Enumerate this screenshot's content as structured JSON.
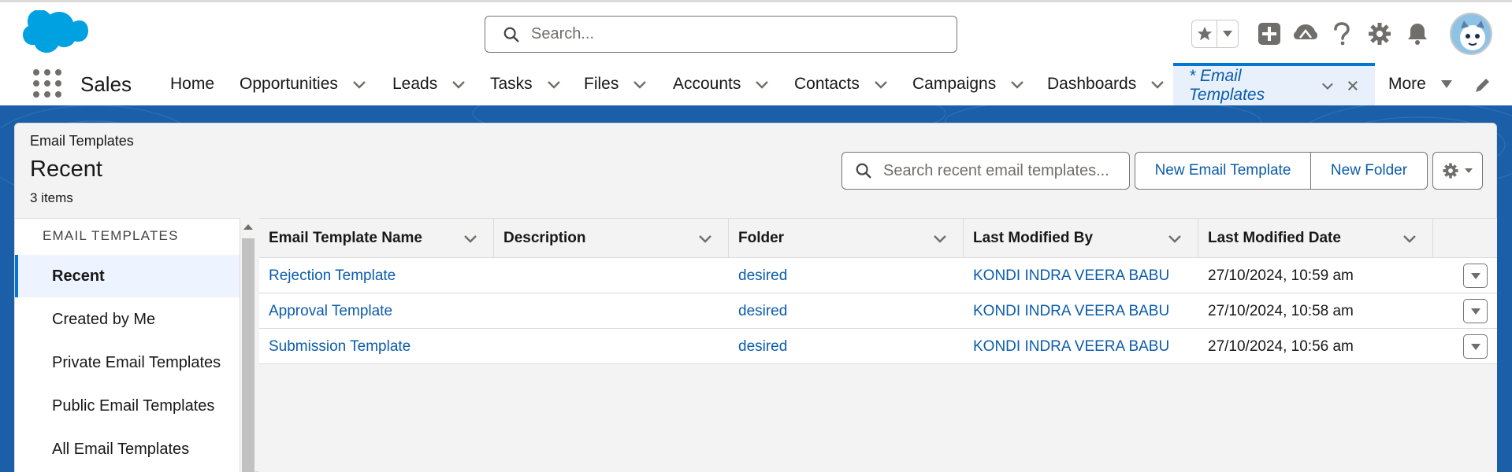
{
  "header": {
    "search_placeholder": "Search..."
  },
  "nav": {
    "app_name": "Sales",
    "items": [
      {
        "label": "Home"
      },
      {
        "label": "Opportunities"
      },
      {
        "label": "Leads"
      },
      {
        "label": "Tasks"
      },
      {
        "label": "Files"
      },
      {
        "label": "Accounts"
      },
      {
        "label": "Contacts"
      },
      {
        "label": "Campaigns"
      },
      {
        "label": "Dashboards"
      }
    ],
    "active_tab": "* Email Templates",
    "more": "More"
  },
  "list": {
    "object_label": "Email Templates",
    "title": "Recent",
    "count": "3 items",
    "search_placeholder": "Search recent email templates...",
    "new_template_btn": "New Email Template",
    "new_folder_btn": "New Folder"
  },
  "sidebar": {
    "heading": "EMAIL TEMPLATES",
    "items": [
      {
        "label": "Recent",
        "active": true
      },
      {
        "label": "Created by Me"
      },
      {
        "label": "Private Email Templates"
      },
      {
        "label": "Public Email Templates"
      },
      {
        "label": "All Email Templates"
      }
    ]
  },
  "table": {
    "columns": [
      "Email Template Name",
      "Description",
      "Folder",
      "Last Modified By",
      "Last Modified Date"
    ],
    "rows": [
      {
        "name": "Rejection Template",
        "description": "",
        "folder": "desired",
        "modified_by": "KONDI INDRA VEERA BABU",
        "modified_date": "27/10/2024, 10:59 am"
      },
      {
        "name": "Approval Template",
        "description": "",
        "folder": "desired",
        "modified_by": "KONDI INDRA VEERA BABU",
        "modified_date": "27/10/2024, 10:58 am"
      },
      {
        "name": "Submission Template",
        "description": "",
        "folder": "desired",
        "modified_by": "KONDI INDRA VEERA BABU",
        "modified_date": "27/10/2024, 10:56 am"
      }
    ]
  },
  "colors": {
    "brand_blue": "#1b5fa8",
    "link": "#0b5cab",
    "accent": "#0176d3",
    "logo": "#00a1e0"
  },
  "icons": [
    "salesforce-cloud-logo",
    "search-icon",
    "star-icon",
    "add-icon",
    "trailhead-icon",
    "help-icon",
    "setup-gear-icon",
    "bell-icon",
    "avatar",
    "app-launcher-icon",
    "chevron-down-icon",
    "close-icon",
    "pencil-icon",
    "gear-icon"
  ]
}
